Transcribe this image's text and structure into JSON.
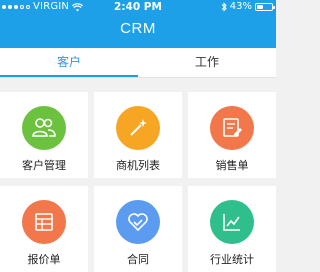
{
  "status_bar": {
    "carrier": "VIRGIN",
    "time": "2:40 PM",
    "battery": "43%",
    "battery_level": 0.43,
    "signal_bars": 5,
    "signal_filled": 3
  },
  "header": {
    "title": "CRM"
  },
  "tabs": [
    {
      "label": "客户",
      "active": true
    },
    {
      "label": "工作",
      "active": false
    }
  ],
  "accent_color": "#1ea0e8",
  "tiles": [
    {
      "label": "客户管理",
      "color": "#6cc23f",
      "icon": "customers-icon"
    },
    {
      "label": "商机列表",
      "color": "#f6a623",
      "icon": "magic-wand-icon"
    },
    {
      "label": "销售单",
      "color": "#f2784b",
      "icon": "sales-order-icon"
    },
    {
      "label": "报价单",
      "color": "#f2784b",
      "icon": "quote-table-icon"
    },
    {
      "label": "合同",
      "color": "#5b9bf0",
      "icon": "contract-heart-icon"
    },
    {
      "label": "行业统计",
      "color": "#2fbf8d",
      "icon": "line-chart-icon"
    }
  ]
}
